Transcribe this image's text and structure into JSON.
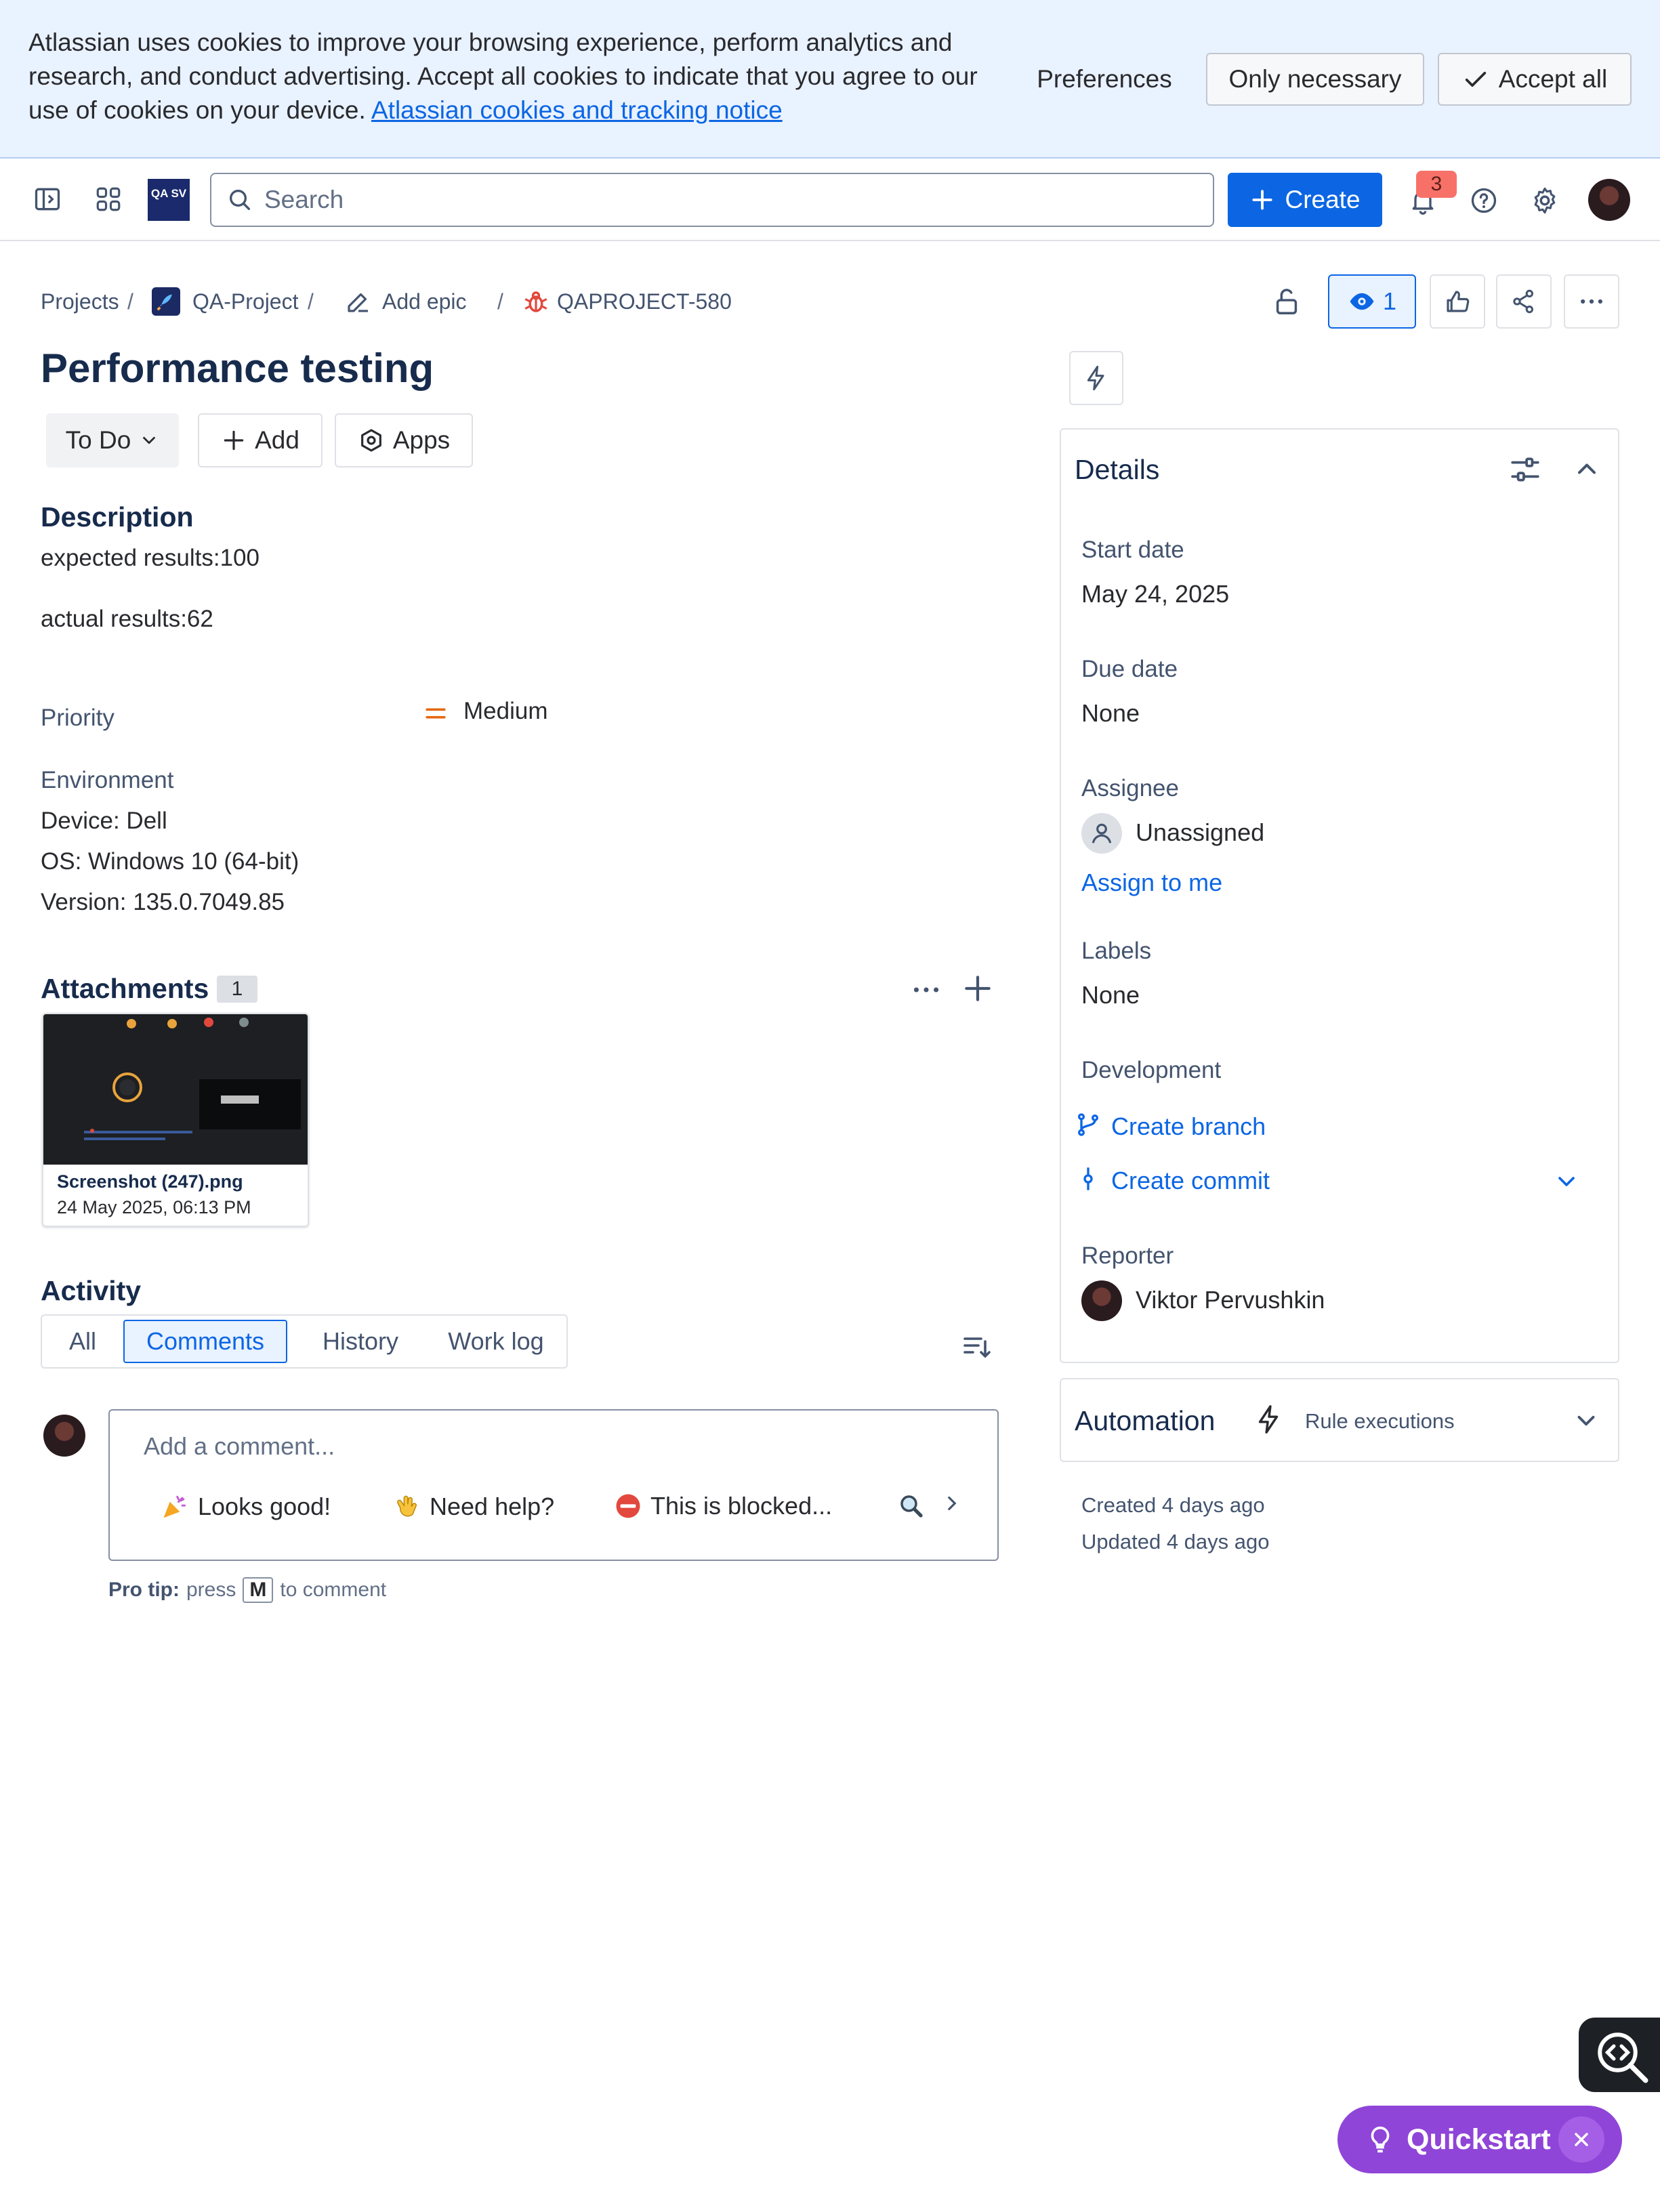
{
  "cookie_banner": {
    "text": "Atlassian uses cookies to improve your browsing experience, perform analytics and research, and conduct advertising. Accept all cookies to indicate that you agree to our use of cookies on your device.",
    "link": "Atlassian cookies and tracking notice",
    "preferences": "Preferences",
    "only_necessary": "Only necessary",
    "accept_all": "Accept all"
  },
  "topnav": {
    "logo_text": "QA SV",
    "search_placeholder": "Search",
    "create_label": "Create",
    "notification_count": "3",
    "icons": [
      "sidebar-toggle-icon",
      "app-switcher-icon",
      "search-icon",
      "plus-icon",
      "bell-icon",
      "help-icon",
      "gear-icon"
    ]
  },
  "breadcrumb": {
    "projects": "Projects",
    "project": "QA-Project",
    "add_epic": "Add epic",
    "issue_key": "QAPROJECT-580"
  },
  "header_actions": {
    "watchers": "1"
  },
  "issue": {
    "title": "Performance testing",
    "status": "To Do",
    "add_label": "Add",
    "apps_label": "Apps",
    "description_heading": "Description",
    "description_lines": [
      "expected results:100",
      "actual results:62"
    ],
    "priority_label": "Priority",
    "priority_value": "Medium",
    "environment_label": "Environment",
    "environment_lines": [
      "Device: Dell",
      "OS: Windows 10 (64-bit)",
      "Version: 135.0.7049.85"
    ]
  },
  "attachments": {
    "heading": "Attachments",
    "count": "1",
    "files": [
      {
        "name": "Screenshot (247).png",
        "date": "24 May 2025, 06:13 PM"
      }
    ]
  },
  "activity": {
    "heading": "Activity",
    "tabs": [
      "All",
      "Comments",
      "History",
      "Work log"
    ],
    "active_tab": "Comments",
    "comment_placeholder": "Add a comment...",
    "quick_replies": [
      "Looks good!",
      "Need help?",
      "This is blocked..."
    ],
    "pro_tip_label": "Pro tip:",
    "pro_tip_press": "press",
    "pro_tip_key": "M",
    "pro_tip_suffix": "to comment"
  },
  "details": {
    "heading": "Details",
    "start_date_label": "Start date",
    "start_date": "May 24, 2025",
    "due_date_label": "Due date",
    "due_date": "None",
    "assignee_label": "Assignee",
    "assignee": "Unassigned",
    "assign_to_me": "Assign to me",
    "labels_label": "Labels",
    "labels": "None",
    "development_label": "Development",
    "create_branch": "Create branch",
    "create_commit": "Create commit",
    "reporter_label": "Reporter",
    "reporter": "Viktor Pervushkin"
  },
  "automation": {
    "heading": "Automation",
    "rule_executions": "Rule executions"
  },
  "timestamps": {
    "created": "Created 4 days ago",
    "updated": "Updated 4 days ago"
  },
  "quickstart": {
    "label": "Quickstart"
  },
  "colors": {
    "primary": "#0c66e4",
    "banner_bg": "#e9f2ff",
    "priority_medium": "#e56910",
    "bug_red": "#e2483d",
    "quickstart_purple": "#8f45d8",
    "badge_red": "#f87168"
  }
}
